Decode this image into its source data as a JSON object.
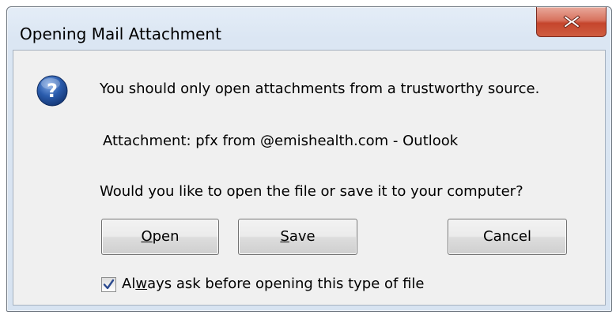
{
  "dialog": {
    "title": "Opening Mail Attachment",
    "close_glyph": "X",
    "icon": "question-icon",
    "message_warning": "You should only open attachments from a trustworthy source.",
    "attachment_line": "Attachment: pfx from @emishealth.com - Outlook",
    "prompt": "Would you like to open the file or save it to your computer?",
    "buttons": {
      "open": {
        "before": "",
        "accel": "O",
        "after": "pen"
      },
      "save": {
        "before": "",
        "accel": "S",
        "after": "ave"
      },
      "cancel": "Cancel"
    },
    "checkbox": {
      "checked": true,
      "label_before": "Al",
      "label_accel": "w",
      "label_after": "ays ask before opening this type of file"
    }
  },
  "colors": {
    "close_button": "#c5452c",
    "question_icon": "#2a5cad",
    "check_mark": "#2b4a8f"
  }
}
